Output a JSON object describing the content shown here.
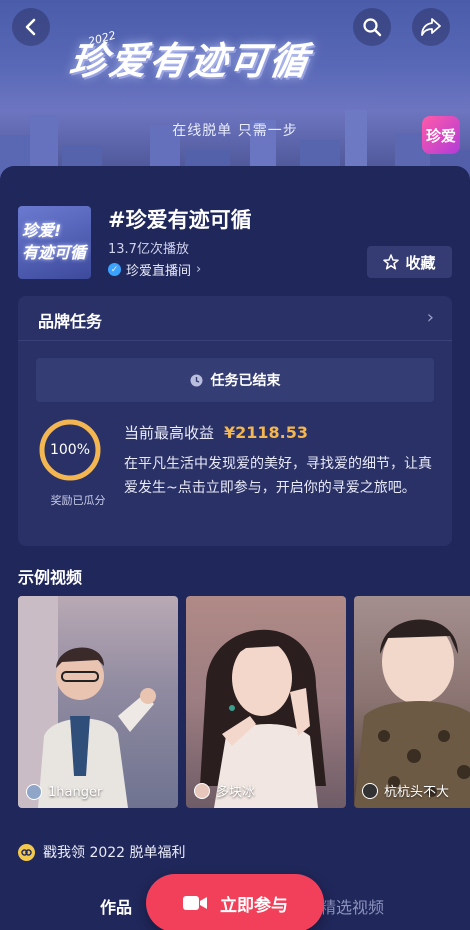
{
  "header": {
    "banner_title": "珍爱有迹可循",
    "banner_year": "2022",
    "banner_subtitle": "在线脱单 只需一步",
    "brand_logo_text": "珍爱"
  },
  "topic": {
    "thumb_text_1": "珍爱!",
    "thumb_text_2": "有迹可循",
    "title": "#珍爱有迹可循",
    "plays": "13.7亿次播放",
    "owner": "珍爱直播间",
    "collect_label": "收藏"
  },
  "brand_task": {
    "heading": "品牌任务",
    "status": "任务已结束",
    "progress_percent": 100,
    "progress_text": "100%",
    "progress_caption": "奖励已瓜分",
    "income_label": "当前最高收益",
    "income_value": "¥2118.53",
    "description": "在平凡生活中发现爱的美好，寻找爱的细节，让真爱发生~点击立即参与，开启你的寻爱之旅吧。"
  },
  "examples": {
    "heading": "示例视频",
    "videos": [
      {
        "author": "1hanger"
      },
      {
        "author": "多块冰"
      },
      {
        "author": "杭杭头不大"
      }
    ]
  },
  "welfare": {
    "text": "戳我领 2022 脱单福利"
  },
  "tabs": {
    "works": "作品",
    "picks": "精选视频"
  },
  "cta": {
    "label": "立即参与"
  },
  "colors": {
    "accent": "#f2405a",
    "income": "#f3b650",
    "card": "#2a3167",
    "background": "#20275a"
  }
}
